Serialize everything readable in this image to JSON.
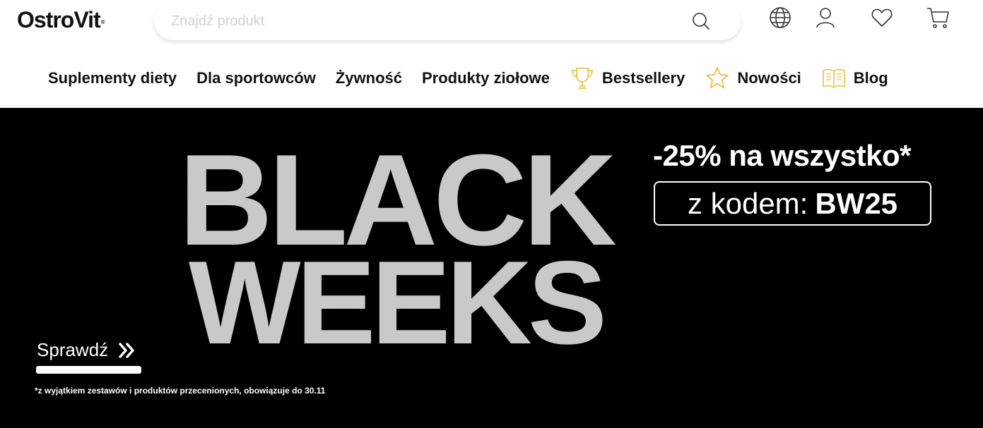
{
  "header": {
    "logo": "OstroVit",
    "logo_mark": "®",
    "search_placeholder": "Znajdź produkt",
    "icons": [
      "search-icon",
      "globe-icon",
      "user-icon",
      "heart-icon",
      "cart-icon"
    ]
  },
  "nav": {
    "items": [
      {
        "label": "Suplementy diety"
      },
      {
        "label": "Dla sportowców"
      },
      {
        "label": "Żywność"
      },
      {
        "label": "Produkty ziołowe"
      },
      {
        "label": "Bestsellery",
        "icon": "trophy-icon"
      },
      {
        "label": "Nowości",
        "icon": "star-icon"
      },
      {
        "label": "Blog",
        "icon": "book-icon"
      }
    ],
    "icon_color": "#e8c24a"
  },
  "banner": {
    "headline_line1": "BLACK",
    "headline_line2": "WEEKS",
    "promo": "-25% na wszystko*",
    "code_prefix": "z kodem:",
    "code": "BW25",
    "cta": "Sprawdź",
    "disclaimer": "*z wyjątkiem zestawów i produktów przecenionych, obowiązuje do 30.11",
    "background": "#000000",
    "text_color": "#ffffff"
  }
}
